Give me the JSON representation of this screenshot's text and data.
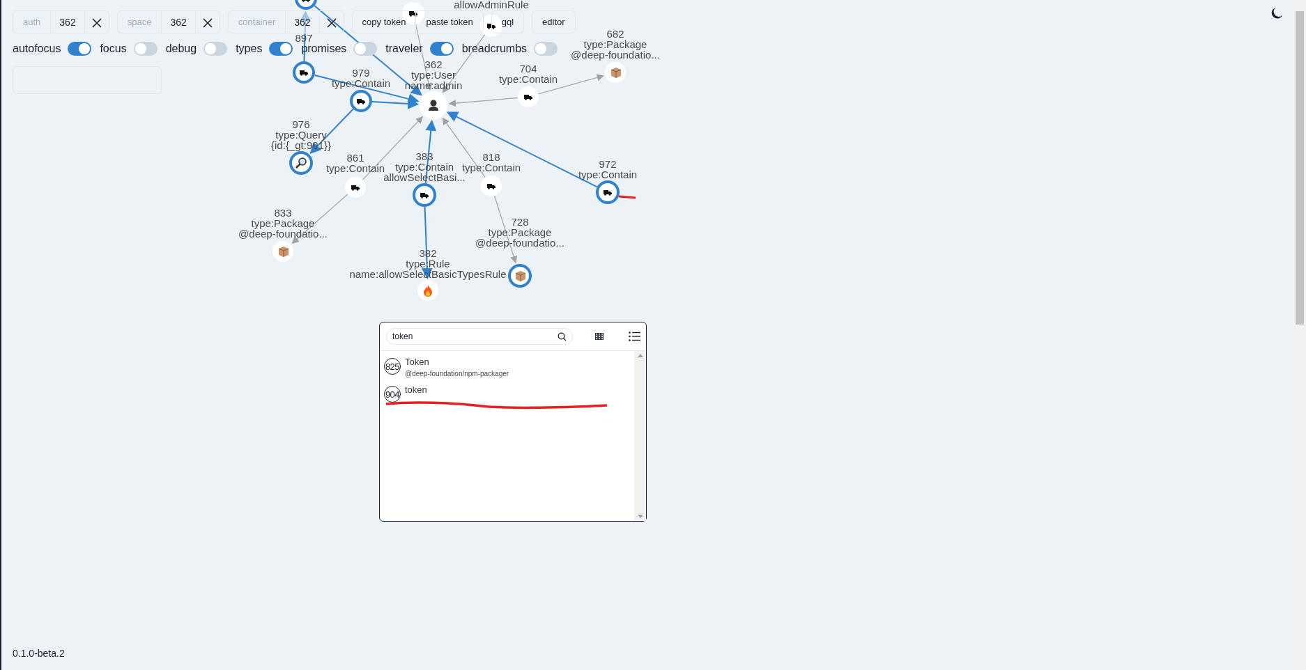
{
  "toolbar": {
    "fields": [
      {
        "label": "auth",
        "value": "362"
      },
      {
        "label": "space",
        "value": "362"
      },
      {
        "label": "container",
        "value": "362"
      }
    ],
    "token_buttons": [
      "copy token",
      "paste token"
    ],
    "buttons": [
      "gql",
      "editor"
    ]
  },
  "toggles": [
    {
      "label": "autofocus",
      "on": true
    },
    {
      "label": "focus",
      "on": false
    },
    {
      "label": "debug",
      "on": false
    },
    {
      "label": "types",
      "on": true
    },
    {
      "label": "promises",
      "on": false
    },
    {
      "label": "traveler",
      "on": true
    },
    {
      "label": "breadcrumbs",
      "on": false
    }
  ],
  "graph": {
    "nodes": [
      {
        "kind": "contain",
        "ring": true
      },
      {
        "kind": "contain",
        "ring": false
      },
      {
        "kind": "contain",
        "lines": [
          "allowAdminRule"
        ],
        "ring": false
      },
      {
        "kind": "contain",
        "lines": [
          "897"
        ],
        "ring": true
      },
      {
        "kind": "package",
        "lines": [
          "682",
          "type:Package",
          "@deep-foundatio..."
        ],
        "ring": false
      },
      {
        "kind": "contain",
        "lines": [
          "979",
          "type:Contain"
        ],
        "ring": true
      },
      {
        "kind": "user",
        "lines": [
          "362",
          "type:User",
          "name:admin"
        ],
        "ring": false
      },
      {
        "kind": "contain",
        "lines": [
          "704",
          "type:Contain"
        ],
        "ring": false
      },
      {
        "kind": "query",
        "lines": [
          "976",
          "type:Query",
          "{id:{_gt:901}}"
        ],
        "ring": true
      },
      {
        "kind": "contain",
        "lines": [
          "861",
          "type:Contain"
        ],
        "ring": false
      },
      {
        "kind": "contain",
        "lines": [
          "383",
          "type:Contain",
          "allowSelectBasi..."
        ],
        "ring": true
      },
      {
        "kind": "contain",
        "lines": [
          "818",
          "type:Contain"
        ],
        "ring": false
      },
      {
        "kind": "contain",
        "lines": [
          "972",
          "type:Contain"
        ],
        "ring": true
      },
      {
        "kind": "package",
        "lines": [
          "833",
          "type:Package",
          "@deep-foundatio..."
        ],
        "ring": false
      },
      {
        "kind": "package",
        "lines": [
          "728",
          "type:Package",
          "@deep-foundatio..."
        ],
        "ring": true
      },
      {
        "kind": "rule",
        "lines": [
          "382",
          "type:Rule",
          "name:allowSelectBasicTypesRule"
        ],
        "ring": false
      }
    ],
    "edges": [
      {
        "highlighted": true
      },
      {
        "highlighted": true
      },
      {
        "highlighted": true
      },
      {
        "highlighted": true
      },
      {
        "highlighted": true
      },
      {
        "highlighted": false
      },
      {
        "highlighted": false
      },
      {
        "highlighted": true
      },
      {
        "highlighted": true
      },
      {
        "highlighted": false
      },
      {
        "highlighted": false
      },
      {
        "highlighted": true
      },
      {
        "highlighted": false
      },
      {
        "highlighted": false
      },
      {
        "highlighted": false
      },
      {
        "highlighted": false
      }
    ]
  },
  "finder": {
    "search": {
      "value": "token"
    },
    "results": [
      {
        "id": "825",
        "title": "Token",
        "subtitle": "@deep-foundation/npm-packager"
      },
      {
        "id": "904",
        "title": "token"
      }
    ]
  },
  "version": "0.1.0-beta.2"
}
